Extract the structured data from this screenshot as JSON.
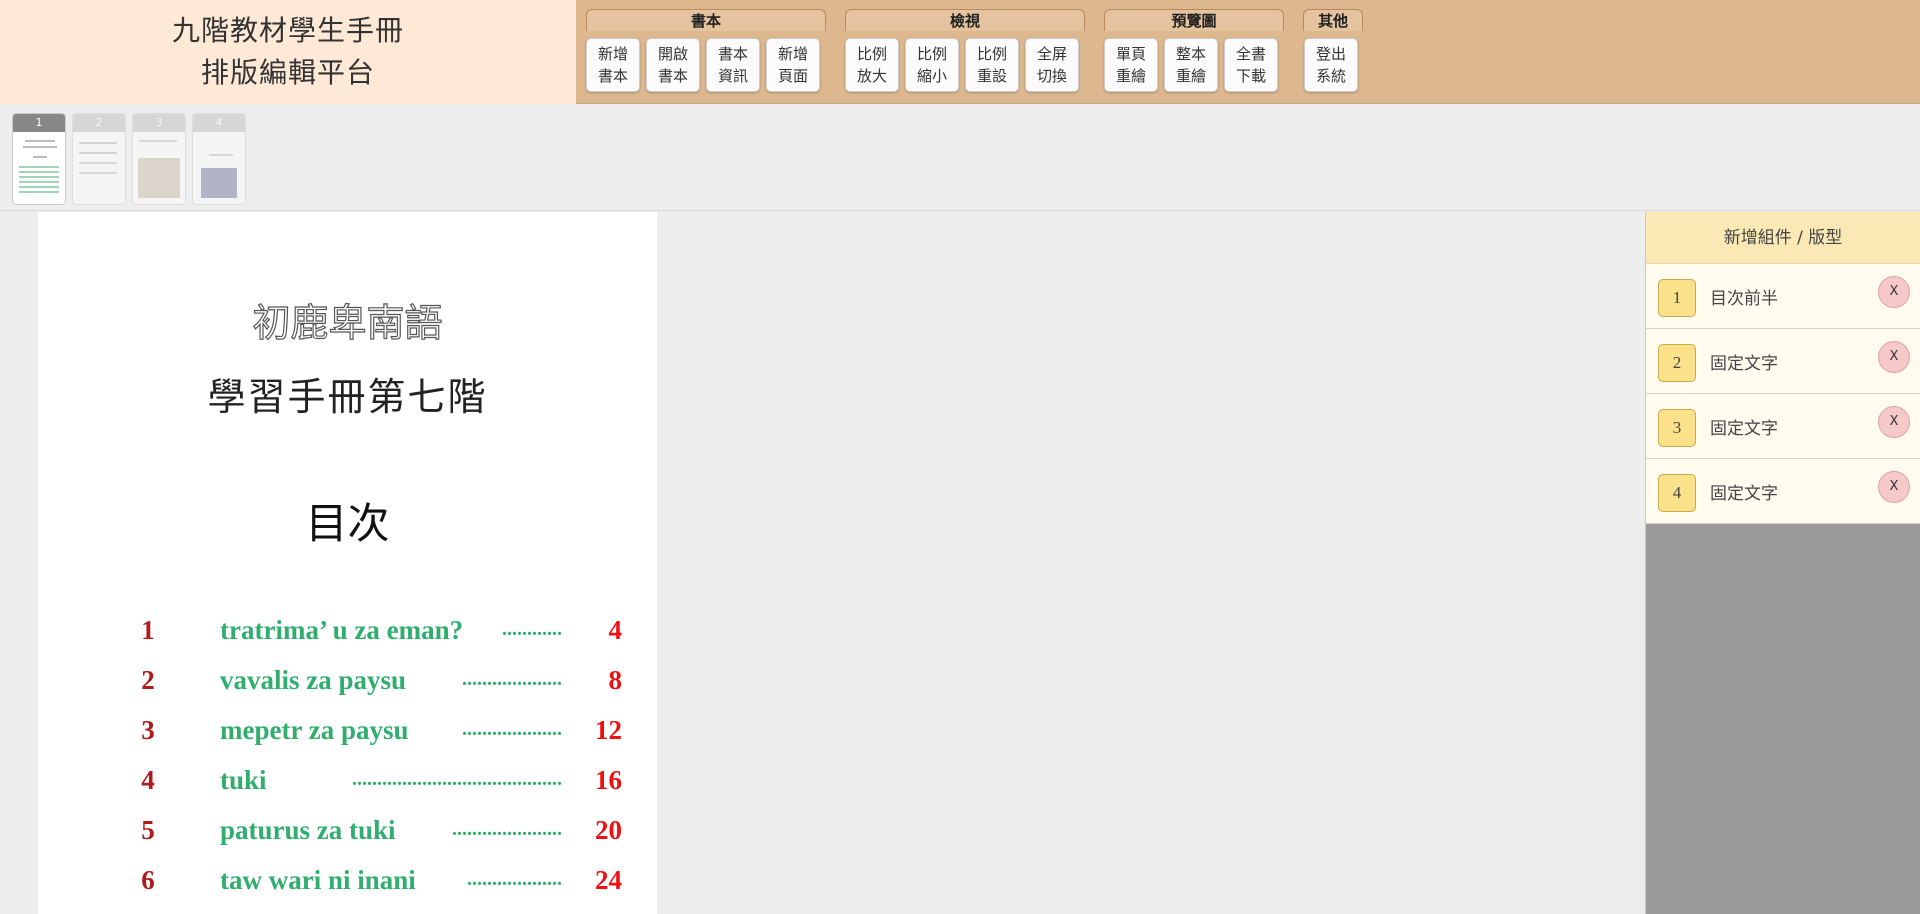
{
  "app": {
    "title_line1": "九階教材學生手冊",
    "title_line2": "排版編輯平台"
  },
  "toolbar": {
    "groups": [
      {
        "title": "書本",
        "buttons": [
          {
            "l1": "新增",
            "l2": "書本"
          },
          {
            "l1": "開啟",
            "l2": "書本"
          },
          {
            "l1": "書本",
            "l2": "資訊"
          },
          {
            "l1": "新增",
            "l2": "頁面"
          }
        ]
      },
      {
        "title": "檢視",
        "buttons": [
          {
            "l1": "比例",
            "l2": "放大"
          },
          {
            "l1": "比例",
            "l2": "縮小"
          },
          {
            "l1": "比例",
            "l2": "重設"
          },
          {
            "l1": "全屏",
            "l2": "切換"
          }
        ]
      },
      {
        "title": "預覽圖",
        "buttons": [
          {
            "l1": "單頁",
            "l2": "重繪"
          },
          {
            "l1": "整本",
            "l2": "重繪"
          },
          {
            "l1": "全書",
            "l2": "下載"
          }
        ]
      },
      {
        "title": "其他",
        "buttons": [
          {
            "l1": "登出",
            "l2": "系統"
          }
        ]
      }
    ]
  },
  "thumbnails": [
    "1",
    "2",
    "3",
    "4"
  ],
  "document": {
    "title_outline": "初鹿卑南語",
    "subtitle": "學習手冊第七階",
    "toc_heading": "目次",
    "toc": [
      {
        "num": "1",
        "text": "tratrima’ u za eman?",
        "dots": "............",
        "page": "4"
      },
      {
        "num": "2",
        "text": "vavalis za paysu",
        "dots": "....................",
        "page": "8"
      },
      {
        "num": "3",
        "text": "mepetr za paysu",
        "dots": "....................",
        "page": "12"
      },
      {
        "num": "4",
        "text": "tuki",
        "dots": "..........................................",
        "page": "16"
      },
      {
        "num": "5",
        "text": "paturus za tuki",
        "dots": "......................",
        "page": "20"
      },
      {
        "num": "6",
        "text": "taw wari ni inani",
        "dots": "...................",
        "page": "24"
      }
    ]
  },
  "panel": {
    "header": "新增組件 / 版型",
    "items": [
      {
        "num": "1",
        "label": "目次前半",
        "del": "X"
      },
      {
        "num": "2",
        "label": "固定文字",
        "del": "X"
      },
      {
        "num": "3",
        "label": "固定文字",
        "del": "X"
      },
      {
        "num": "4",
        "label": "固定文字",
        "del": "X"
      }
    ]
  }
}
